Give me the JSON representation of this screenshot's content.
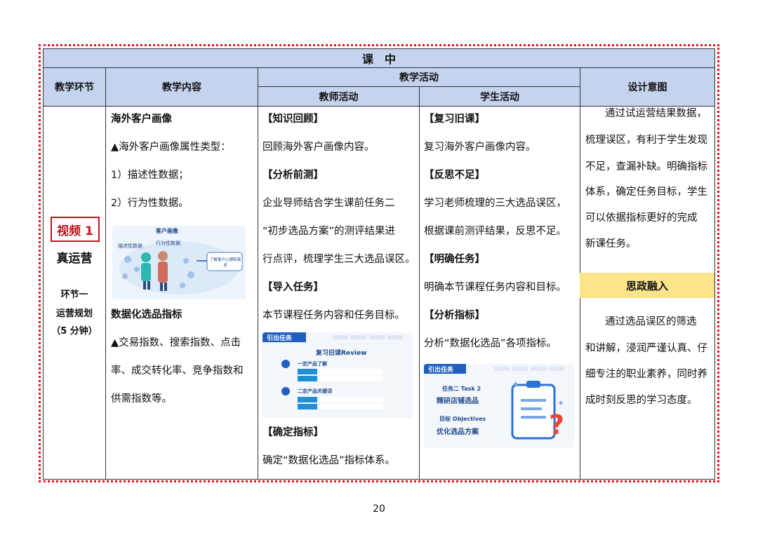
{
  "header": {
    "title": "课　中",
    "col_stage": "教学环节",
    "col_content": "教学内容",
    "col_activity": "教学活动",
    "col_teacher": "教师活动",
    "col_student": "学生活动",
    "col_intent": "设计意图"
  },
  "stage": {
    "tag": "视频 1",
    "name": "真运营",
    "sub1": "环节一",
    "sub2": "运营规划",
    "sub3": "（5 分钟）"
  },
  "content": {
    "h1": "海外客户画像",
    "l1": "▲海外客户画像属性类型：",
    "l2": "1）描述性数据；",
    "l3": "2）行为性数据。",
    "img_title": "客户画像",
    "img_left": "描述性数据",
    "img_right": "行为性数据",
    "img_box": "了解客户心理和需求",
    "h2": "数据化选品指标",
    "p1": "▲交易指数、搜索指数、点击",
    "p2": "率、成交转化率、竞争指数和",
    "p3": "供需指数等。"
  },
  "teacher": {
    "h1": "【知识回顾】",
    "t1": "回顾海外客户画像内容。",
    "h2": "【分析前测】",
    "t2a": "企业导师结合学生课前任务二",
    "t2b": "“初步选品方案”的测评结果进",
    "t2c": "行点评，梳理学生三大选品误区。",
    "h3": "【导入任务】",
    "t3": "本节课程任务内容和任务目标。",
    "img_banner": "引出任务",
    "img_title": "复习旧课Review",
    "img_r1": "一定产品了解",
    "img_r2": "二定产品关键词",
    "h4": "【确定指标】",
    "t4": "确定“数据化选品”指标体系。"
  },
  "student": {
    "h1": "【复习旧课】",
    "t1": "复习海外客户画像内容。",
    "h2": "【反思不足】",
    "t2a": "学习老师梳理的三大选品误区，",
    "t2b": "根据课前测评结果，反思不足。",
    "h3": "【明确任务】",
    "t3": "明确本节课程任务内容和目标。",
    "h4": "【分析指标】",
    "t4": "分析“数据化选品”各项指标。",
    "img_banner": "引出任务",
    "img_task": "任务二 Task 2",
    "img_line1": "精研店铺选品",
    "img_goal": "目标 Objectives",
    "img_line2": "优化选品方案"
  },
  "intent": {
    "a1": "通过试运营结果数据，",
    "a2": "梳理误区，有利于学生发现",
    "a3": "不足，查漏补缺。明确指标",
    "a4": "体系，确定任务目标，学生",
    "a5": "可以依据指标更好的完成",
    "a6": "新课任务。",
    "ideo": "思政融入",
    "b1": "通过选品误区的筛选",
    "b2": "和讲解，浸润严谨认真、仔",
    "b3": "细专注的职业素养，同时养",
    "b4": "成时刻反思的学习态度。"
  },
  "page_number": "20",
  "colors": {
    "header_bg": "#c5d3ef",
    "frame": "#e0141e",
    "ideo_bg": "#fde48a",
    "tag": "#c0141e"
  }
}
